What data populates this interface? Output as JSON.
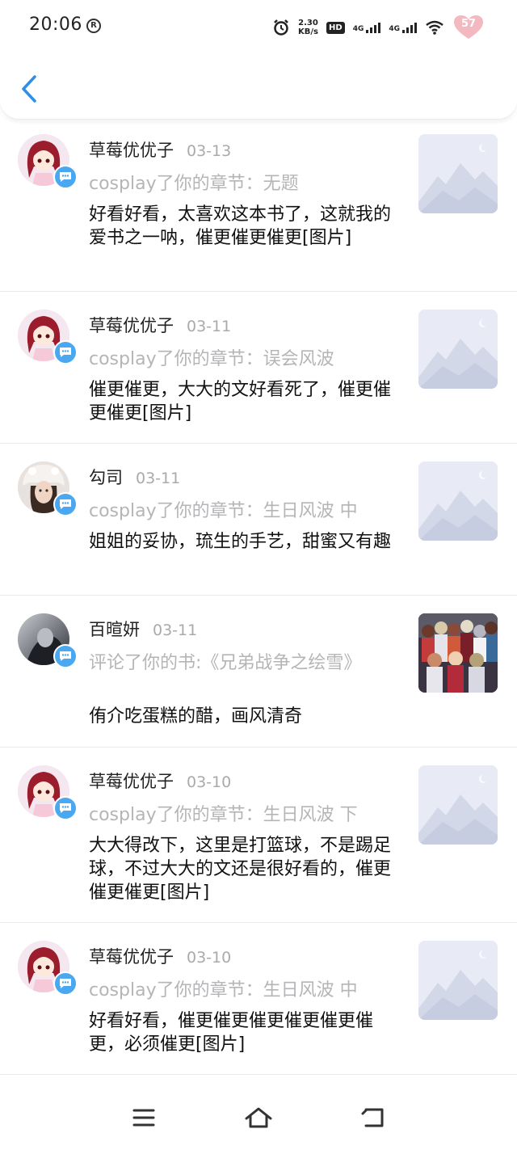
{
  "status_bar": {
    "time": "20:06",
    "r_icon": "R",
    "speed_top": "2.30",
    "speed_bottom": "KB/s",
    "hd_label": "HD",
    "net1": "4G",
    "net2": "4G",
    "battery_level": "57"
  },
  "header": {
    "back_icon": "chevron-left-icon",
    "accent_color": "#2f8fe6"
  },
  "notifications": [
    {
      "user": "草莓优优子",
      "date": "03-13",
      "action": "cosplay了你的章节：无题",
      "content": "好看好看，太喜欢这本书了，这就我的爱书之一呐，催更催更催更[图片]",
      "avatar": "anime-girl",
      "thumb": "placeholder"
    },
    {
      "user": "草莓优优子",
      "date": "03-11",
      "action": "cosplay了你的章节：误会风波",
      "content": "催更催更，大大的文好看死了，催更催更催更[图片]",
      "avatar": "anime-girl",
      "thumb": "placeholder"
    },
    {
      "user": "勾司",
      "date": "03-11",
      "action": "cosplay了你的章节：生日风波 中",
      "content": "姐姐的妥协，琉生的手艺，甜蜜又有趣",
      "avatar": "photo-girl",
      "thumb": "placeholder"
    },
    {
      "user": "百暄妍",
      "date": "03-11",
      "action": "评论了你的书:《兄弟战争之绘雪》",
      "content": "侑介吃蛋糕的醋，画风清奇",
      "avatar": "dark-photo",
      "thumb": "anime-cover"
    },
    {
      "user": "草莓优优子",
      "date": "03-10",
      "action": "cosplay了你的章节：生日风波  下",
      "content": "大大得改下，这里是打篮球，不是踢足球，不过大大的文还是很好看的，催更催更催更[图片]",
      "avatar": "anime-girl",
      "thumb": "placeholder"
    },
    {
      "user": "草莓优优子",
      "date": "03-10",
      "action": "cosplay了你的章节：生日风波 中",
      "content": "好看好看，催更催更催更催更催更催更，必须催更[图片]",
      "avatar": "anime-girl",
      "thumb": "placeholder"
    }
  ],
  "nav_bar": {
    "menu_icon": "menu-icon",
    "home_icon": "home-icon",
    "back_icon": "back-icon"
  }
}
